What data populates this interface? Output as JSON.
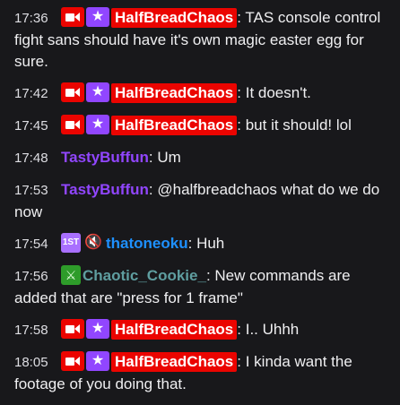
{
  "colors": {
    "background": "#18181b",
    "text": "#efeff1",
    "highlight_name_bg": "#eb0400",
    "name_tastybuffun": "#9146ff",
    "name_thatoneoku": "#1e90ff",
    "name_chaotic_cookie": "#5f9ea0"
  },
  "messages": [
    {
      "time": "17:36",
      "badges": [
        "camera-icon",
        "prime-star-icon"
      ],
      "user": "HalfBreadChaos",
      "text": "TAS console control fight sans should have it's own magic easter egg for sure."
    },
    {
      "time": "17:42",
      "badges": [
        "camera-icon",
        "prime-star-icon"
      ],
      "user": "HalfBreadChaos",
      "text": "It doesn't."
    },
    {
      "time": "17:45",
      "badges": [
        "camera-icon",
        "prime-star-icon"
      ],
      "user": "HalfBreadChaos",
      "text": "but it should! lol"
    },
    {
      "time": "17:48",
      "badges": [],
      "user": "TastyBuffun",
      "text": "Um"
    },
    {
      "time": "17:53",
      "badges": [],
      "user": "TastyBuffun",
      "text": "@halfbreadchaos what do we do now"
    },
    {
      "time": "17:54",
      "badges": [
        "first-sub-icon",
        "muted-speaker-icon"
      ],
      "first_badge_text": "1ST",
      "user": "thatoneoku",
      "text": "Huh"
    },
    {
      "time": "17:56",
      "badges": [
        "sword-icon"
      ],
      "user": "Chaotic_Cookie_",
      "text": "New commands are added that are \"press for 1 frame\""
    },
    {
      "time": "17:58",
      "badges": [
        "camera-icon",
        "prime-star-icon"
      ],
      "user": "HalfBreadChaos",
      "text": "I.. Uhhh"
    },
    {
      "time": "18:05",
      "badges": [
        "camera-icon",
        "prime-star-icon"
      ],
      "user": "HalfBreadChaos",
      "text": "I kinda want the footage of you doing that."
    }
  ]
}
